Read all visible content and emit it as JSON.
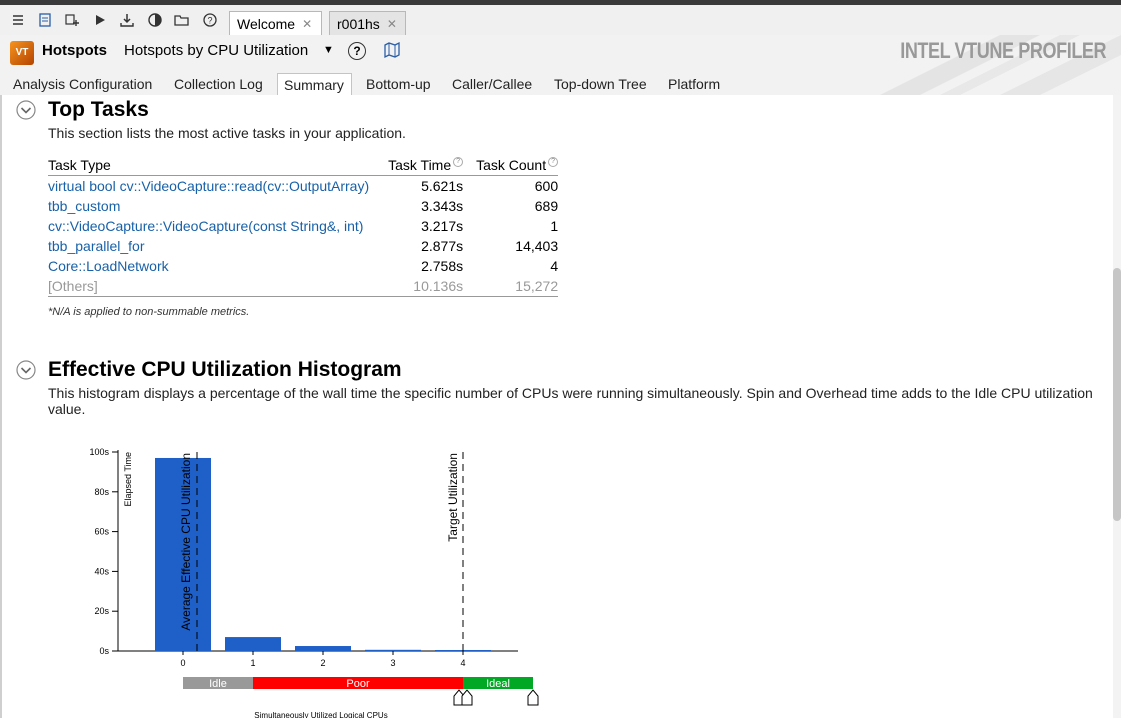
{
  "toolbar": {
    "icons": [
      "menu-icon",
      "new-project-icon",
      "new-analysis-icon",
      "start-icon",
      "import-icon",
      "compare-icon",
      "open-icon",
      "help-icon"
    ],
    "tabs": [
      {
        "label": "Welcome",
        "active": true
      },
      {
        "label": "r001hs",
        "active": false
      }
    ]
  },
  "header": {
    "analysis": "Hotspots",
    "analysis_type": "Hotspots by CPU Utilization",
    "help": "?",
    "logo": "INTEL VTUNE PROFILER",
    "nav_tabs": [
      "Analysis Configuration",
      "Collection Log",
      "Summary",
      "Bottom-up",
      "Caller/Callee",
      "Top-down Tree",
      "Platform"
    ],
    "active_nav": "Summary"
  },
  "top_tasks": {
    "title": "Top Tasks",
    "description": "This section lists the most active tasks in your application.",
    "columns": [
      "Task Type",
      "Task Time",
      "Task Count"
    ],
    "rows": [
      {
        "type": "virtual bool cv::VideoCapture::read(cv::OutputArray)",
        "time": "5.621s",
        "count": "600"
      },
      {
        "type": "tbb_custom",
        "time": "3.343s",
        "count": "689"
      },
      {
        "type": "cv::VideoCapture::VideoCapture(const String&, int)",
        "time": "3.217s",
        "count": "1"
      },
      {
        "type": "tbb_parallel_for",
        "time": "2.877s",
        "count": "14,403"
      },
      {
        "type": "Core::LoadNetwork",
        "time": "2.758s",
        "count": "4"
      }
    ],
    "others": {
      "type": "[Others]",
      "time": "10.136s",
      "count": "15,272"
    },
    "note": "*N/A is applied to non-summable metrics."
  },
  "histogram": {
    "title": "Effective CPU Utilization Histogram",
    "description": "This histogram displays a percentage of the wall time the specific number of CPUs were running simultaneously. Spin and Overhead time adds to the Idle CPU utilization value."
  },
  "chart_data": {
    "type": "bar",
    "categories": [
      "0",
      "1",
      "2",
      "3",
      "4"
    ],
    "values": [
      97,
      7,
      2.5,
      0.6,
      0.5
    ],
    "ylabel": "Elapsed Time",
    "ylim": [
      0,
      100
    ],
    "y_ticks": [
      "0s",
      "20s",
      "40s",
      "60s",
      "80s",
      "100s"
    ],
    "xlabel": "Simultaneously Utilized Logical CPUs",
    "average_effective_cpu_utilization": 0.2,
    "average_label": "Average Effective CPU Utilization",
    "target_utilization": 4,
    "target_label": "Target Utilization",
    "bar_color": "#1f5fc8",
    "bands": [
      {
        "label": "Idle",
        "from": -0.5,
        "to": 0.5,
        "color": "#999999"
      },
      {
        "label": "Poor",
        "from": 0.5,
        "to": 3.5,
        "color": "#ff0000"
      },
      {
        "label": "Ideal",
        "from": 3.5,
        "to": 4.5,
        "color": "#00a826"
      }
    ]
  }
}
